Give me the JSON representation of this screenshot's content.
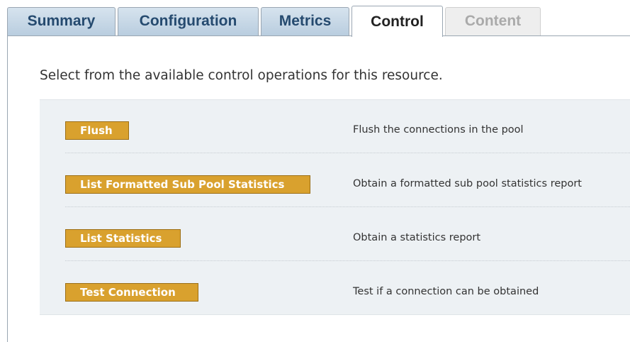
{
  "tabs": [
    {
      "label": "Summary"
    },
    {
      "label": "Configuration"
    },
    {
      "label": "Metrics"
    },
    {
      "label": "Control"
    },
    {
      "label": "Content"
    }
  ],
  "intro_text": "Select from the available control operations for this resource.",
  "operations": [
    {
      "button_label": "Flush",
      "description": "Flush the connections in the pool"
    },
    {
      "button_label": "List Formatted Sub Pool Statistics",
      "description": "Obtain a formatted sub pool statistics report"
    },
    {
      "button_label": "List Statistics",
      "description": "Obtain a statistics report"
    },
    {
      "button_label": "Test Connection",
      "description": "Test if a connection can be obtained"
    }
  ],
  "colors": {
    "tab_text": "#254a6f",
    "button_bg": "#d9a12e",
    "panel_bg": "#edf1f4"
  }
}
